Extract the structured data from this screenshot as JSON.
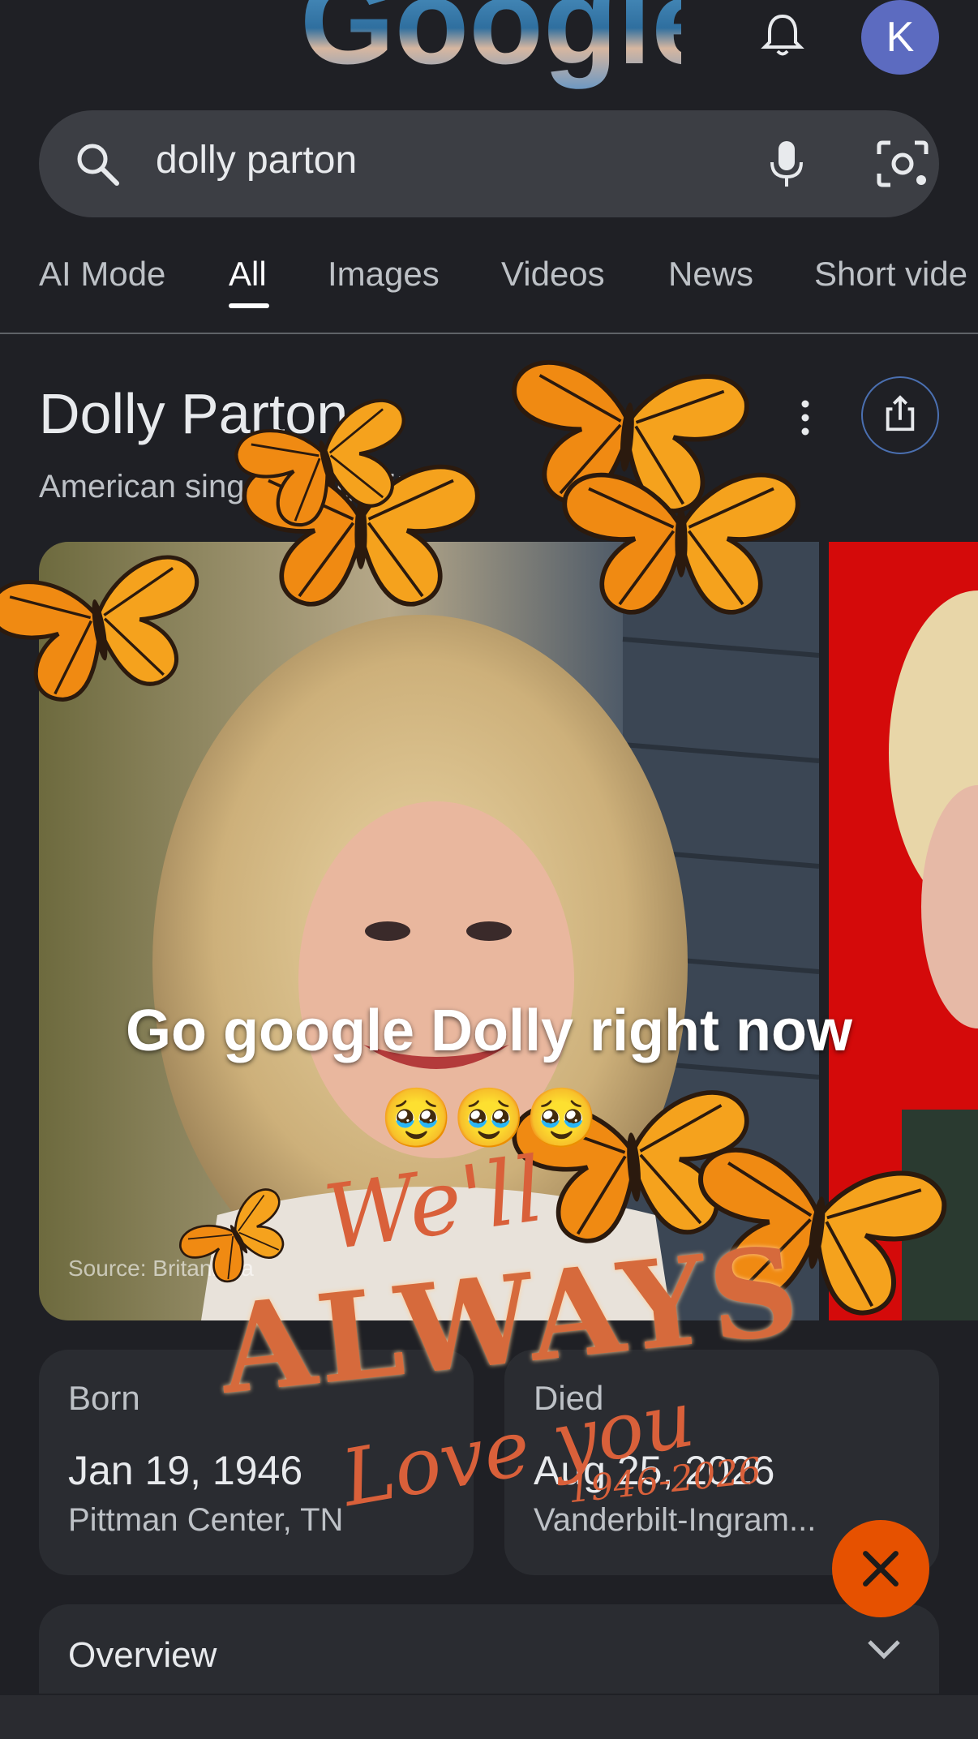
{
  "header": {
    "logo_text": "Google",
    "notifications_icon": "bell-icon",
    "avatar_initial": "K",
    "avatar_color": "#5c6bc0"
  },
  "search": {
    "query": "dolly parton",
    "search_icon": "search-icon",
    "voice_icon": "mic-icon",
    "lens_icon": "lens-icon"
  },
  "tabs": [
    {
      "label": "AI Mode",
      "active": false
    },
    {
      "label": "All",
      "active": true
    },
    {
      "label": "Images",
      "active": false
    },
    {
      "label": "Videos",
      "active": false
    },
    {
      "label": "News",
      "active": false
    },
    {
      "label": "Short vide",
      "active": false
    }
  ],
  "knowledge_panel": {
    "title": "Dolly Parton",
    "subtitle": "American singer-songwriter",
    "more_icon": "more-vert-icon",
    "share_icon": "share-icon",
    "image_source": "Source: Britannica"
  },
  "overlay": {
    "caption": "Go google Dolly right now",
    "emojis": "🥹🥹🥹",
    "sticker_line1": "We'll",
    "sticker_line2": "ALWAYS",
    "sticker_line3": "Love you",
    "sticker_years": "1946-2026"
  },
  "facts": {
    "born": {
      "label": "Born",
      "date": "Jan 19, 1946",
      "place": "Pittman Center, TN"
    },
    "died": {
      "label": "Died",
      "date": "Aug 25, 2026",
      "place": "Vanderbilt-Ingram..."
    }
  },
  "close_button_icon": "close-icon",
  "overview": {
    "label": "Overview",
    "chevron_icon": "chevron-down-icon"
  },
  "colors": {
    "background": "#1f2025",
    "accent": "#e65100",
    "butterfly": "#f08a12"
  }
}
